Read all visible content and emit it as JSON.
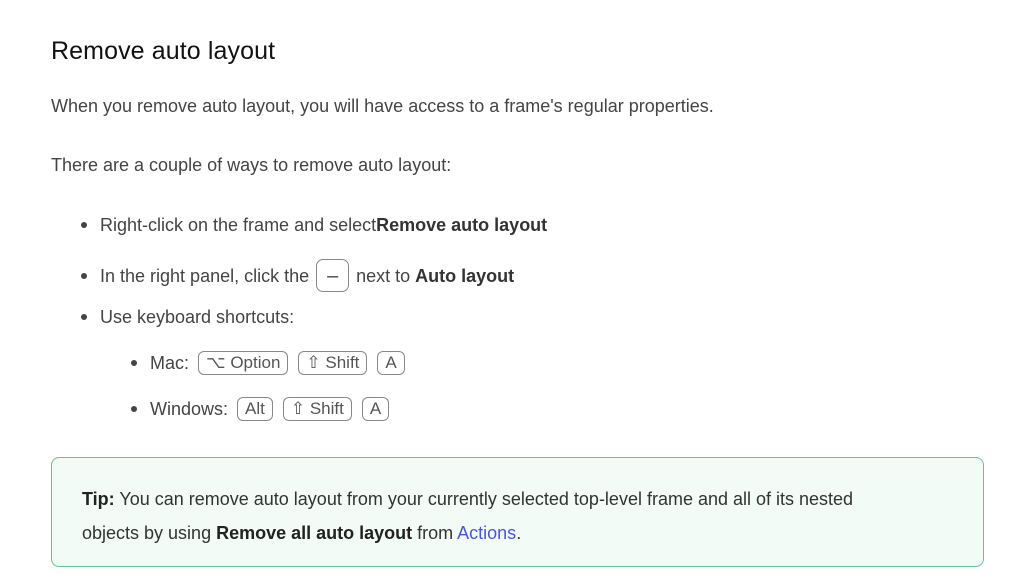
{
  "title": "Remove auto layout",
  "intro": "When you remove auto layout, you will have access to a frame's regular properties.",
  "ways_intro": "There are a couple of ways to remove auto layout:",
  "list": {
    "item1": {
      "text": "Right-click on the frame and select ",
      "strong": "Remove auto layout"
    },
    "item2": {
      "before": "In the right panel, click the",
      "button_icon": "minus-icon",
      "button_glyph": "–",
      "after": "next to ",
      "strong": "Auto layout"
    },
    "item3": {
      "text": "Use keyboard shortcuts:",
      "mac": {
        "label": "Mac:",
        "keys": [
          "⌥ Option",
          "⇧ Shift",
          "A"
        ]
      },
      "windows": {
        "label": "Windows:",
        "keys": [
          "Alt",
          "⇧ Shift",
          "A"
        ]
      }
    }
  },
  "tip": {
    "label": "Tip:",
    "text1": " You can remove auto layout from your currently selected top-level frame and all of its nested objects by using ",
    "strong": "Remove all auto layout",
    "text2": " from ",
    "link": "Actions",
    "end": ".",
    "colors": {
      "background": "#f2fbf5",
      "border": "#62c792",
      "link": "#4a55d6"
    }
  }
}
